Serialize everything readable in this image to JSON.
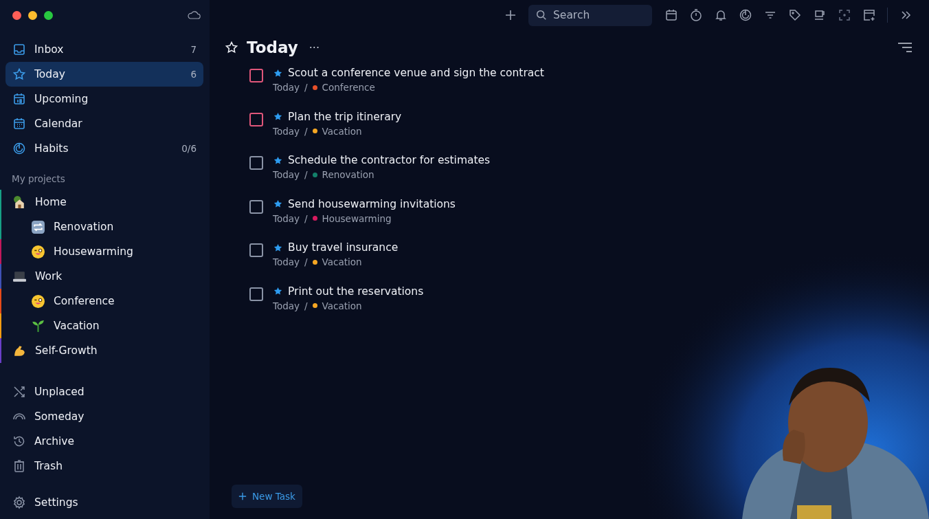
{
  "sidebar": {
    "nav": [
      {
        "kind": "inbox",
        "label": "Inbox",
        "count": "7",
        "selected": false
      },
      {
        "kind": "today",
        "label": "Today",
        "count": "6",
        "selected": true
      },
      {
        "kind": "upcoming",
        "label": "Upcoming",
        "selected": false
      },
      {
        "kind": "calendar",
        "label": "Calendar",
        "selected": false
      },
      {
        "kind": "habits",
        "label": "Habits",
        "count": "0/6",
        "selected": false
      }
    ],
    "projects_heading": "My projects",
    "projects": [
      {
        "kind": "house",
        "label": "Home",
        "color": "#16a085",
        "children": [
          {
            "kind": "repeat",
            "label": "Renovation",
            "color": "#16a085"
          },
          {
            "kind": "wink",
            "label": "Housewarming",
            "color": "#c2185b"
          }
        ]
      },
      {
        "kind": "laptop",
        "label": "Work",
        "color": "#3f51b5",
        "children": [
          {
            "kind": "wink",
            "label": "Conference",
            "color": "#e64a19"
          },
          {
            "kind": "sprout",
            "label": "Vacation",
            "color": "#f39c12"
          }
        ]
      },
      {
        "kind": "arm",
        "label": "Self-Growth",
        "color": "#6a3fc8"
      }
    ],
    "footer": [
      {
        "kind": "unplaced",
        "label": "Unplaced"
      },
      {
        "kind": "someday",
        "label": "Someday"
      },
      {
        "kind": "archive",
        "label": "Archive"
      },
      {
        "kind": "trash",
        "label": "Trash"
      }
    ],
    "settings": "Settings"
  },
  "toolbar": {
    "search": {
      "placeholder": "Search"
    }
  },
  "view": {
    "title": "Today",
    "more": "···"
  },
  "tasks": [
    {
      "title": "Scout a conference venue and sign the contract",
      "when": "Today",
      "project": "Conference",
      "color": "#e8502a",
      "checkbox": {
        "color": "#e0567a"
      },
      "starred": true,
      "separator": "/"
    },
    {
      "title": "Plan the trip itinerary",
      "when": "Today",
      "project": "Vacation",
      "color": "#f5a623",
      "checkbox": {
        "color": "#e0567a"
      },
      "starred": true,
      "separator": "/"
    },
    {
      "title": "Schedule the contractor for estimates",
      "when": "Today",
      "project": "Renovation",
      "color": "#13806a",
      "checkbox": {
        "color": "#8a93a6"
      },
      "starred": true,
      "separator": "/"
    },
    {
      "title": "Send housewarming invitations",
      "when": "Today",
      "project": "Housewarming",
      "color": "#d81b60",
      "checkbox": {
        "color": "#8a93a6"
      },
      "starred": true,
      "separator": "/"
    },
    {
      "title": "Buy travel insurance",
      "when": "Today",
      "project": "Vacation",
      "color": "#f5a623",
      "checkbox": {
        "color": "#8a93a6"
      },
      "starred": true,
      "separator": "/"
    },
    {
      "title": "Print out the reservations",
      "when": "Today",
      "project": "Vacation",
      "color": "#f5a623",
      "checkbox": {
        "color": "#8a93a6"
      },
      "starred": true,
      "separator": "/"
    }
  ],
  "new_task": "New Task"
}
